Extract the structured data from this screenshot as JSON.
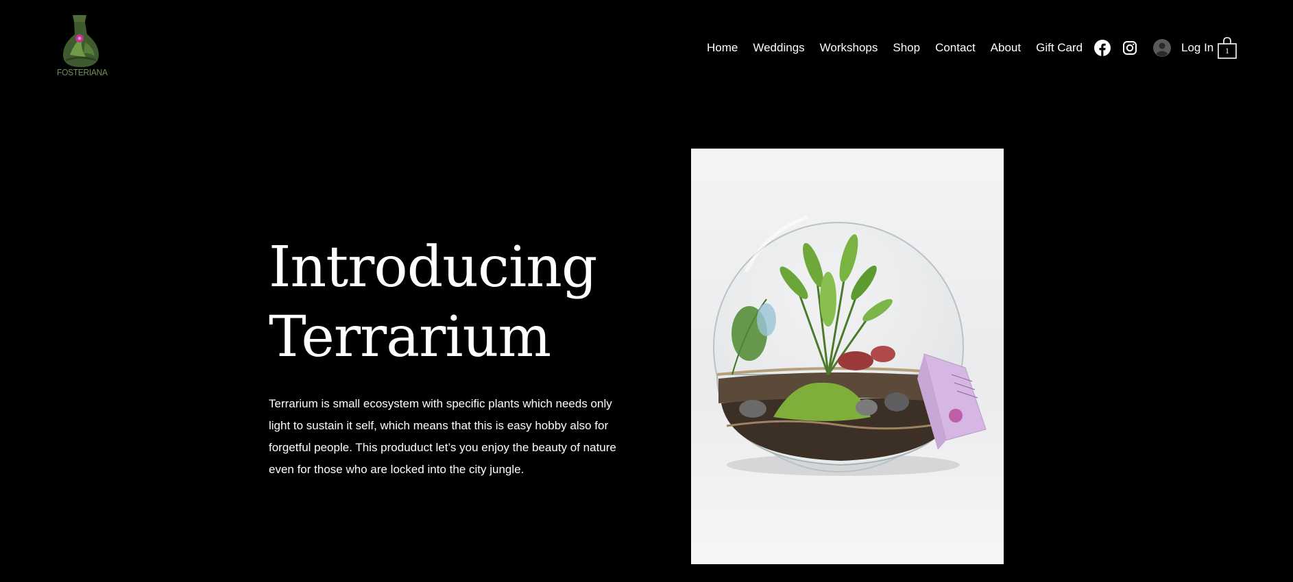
{
  "brand": {
    "logo_text": "FOSTERIANA"
  },
  "nav": {
    "items": [
      {
        "label": "Home"
      },
      {
        "label": "Weddings"
      },
      {
        "label": "Workshops"
      },
      {
        "label": "Shop"
      },
      {
        "label": "Contact"
      },
      {
        "label": "About"
      },
      {
        "label": "Gift Card"
      }
    ]
  },
  "social": {
    "icons": [
      "facebook-icon",
      "instagram-icon"
    ]
  },
  "account": {
    "login_label": "Log In",
    "icon": "avatar-icon"
  },
  "cart": {
    "count": "1",
    "icon": "shopping-bag-icon"
  },
  "hero": {
    "headline_line1": "Introducing",
    "headline_line2": "Terrarium",
    "body": "Terrarium is small ecosystem with specific plants which needs only light to sustain it self, which means that this is easy hobby also for forgetful people. This produduct let’s you enjoy the beauty of nature even for those who are locked into the city jungle."
  },
  "colors": {
    "background": "#000000",
    "text": "#ffffff",
    "logo_green": "#4f6b3c",
    "logo_pink": "#b5378f"
  }
}
